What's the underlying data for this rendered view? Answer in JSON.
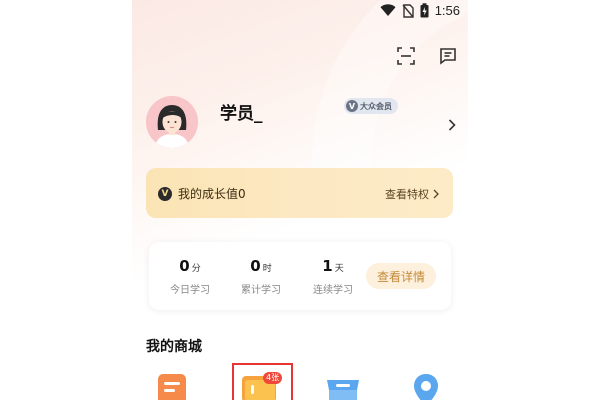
{
  "status_bar": {
    "time": "1:56"
  },
  "top_actions": {
    "scan_icon": "scan-icon",
    "message_icon": "message-icon"
  },
  "profile": {
    "name": "学员_",
    "member_badge_text": "大众会员",
    "member_badge_icon": "V"
  },
  "growth": {
    "icon": "V",
    "label": "我的成长值0",
    "link": "查看特权"
  },
  "stats": [
    {
      "value": "0",
      "unit": "分",
      "label": "今日学习"
    },
    {
      "value": "0",
      "unit": "时",
      "label": "累计学习"
    },
    {
      "value": "1",
      "unit": "天",
      "label": "连续学习"
    }
  ],
  "stats_detail_button": "查看详情",
  "shop": {
    "title": "我的商城",
    "coupon_badge": "4张"
  },
  "colors": {
    "accent_gold": "#c48a3a",
    "highlight_red": "#e83434",
    "badge_red": "#f0473b"
  }
}
